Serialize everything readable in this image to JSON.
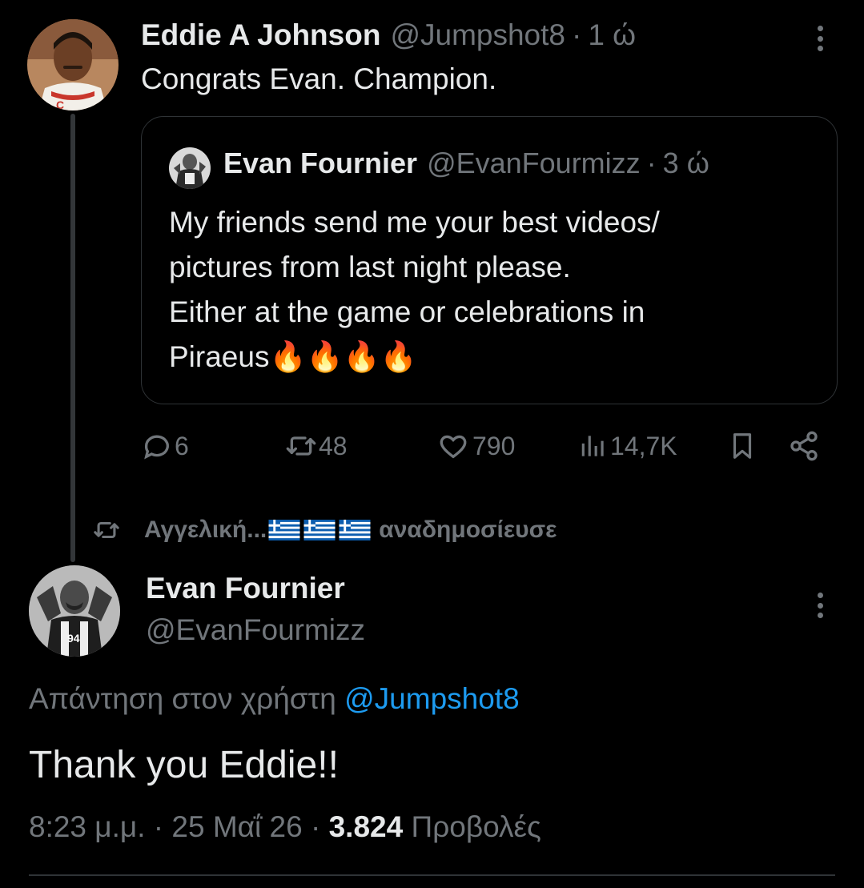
{
  "tweet1": {
    "author_name": "Eddie A Johnson",
    "author_handle": "@Jumpshot8",
    "separator": "·",
    "time": "1 ώ",
    "text": "Congrats Evan. Champion.",
    "avatar_icon": "player-portrait-avatar",
    "quote": {
      "author_name": "Evan Fournier",
      "author_handle": "@EvanFourmizz",
      "time": "3 ώ",
      "text": "My friends send me your best videos/\npictures from last night please.\n Either at the game or celebrations in\nPiraeus",
      "emoji": "🔥🔥🔥🔥"
    },
    "actions": {
      "replies": "6",
      "retweets": "48",
      "likes": "790",
      "views": "14,7K"
    }
  },
  "retweet_context": {
    "name": "Αγγελική...",
    "flags": [
      "greek-flag",
      "greek-flag",
      "greek-flag"
    ],
    "action": "αναδημοσίευσε"
  },
  "tweet2": {
    "author_name": "Evan Fournier",
    "author_handle": "@EvanFourmizz",
    "reply_prefix": "Απάντηση στον χρήστη",
    "reply_target": "@Jumpshot8",
    "text": "Thank you Eddie!!",
    "time": "8:23 μ.μ.",
    "separator": "·",
    "date": "25 Μαΐ 26",
    "views_count": "3.824",
    "views_label": "Προβολές"
  },
  "colors": {
    "background": "#000000",
    "text": "#e7e9ea",
    "muted": "#71767b",
    "link": "#1d9bf0",
    "border": "#2f3336"
  }
}
